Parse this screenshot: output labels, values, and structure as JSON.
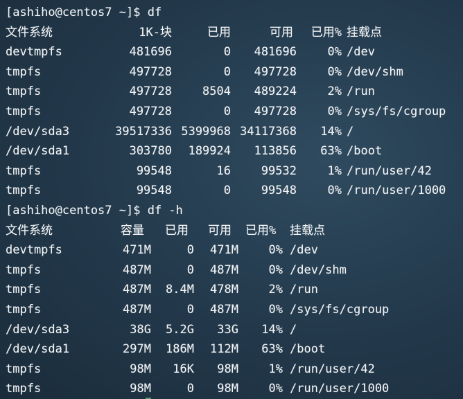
{
  "session1": {
    "prompt": "[ashiho@centos7 ~]$ ",
    "command": "df",
    "headers": [
      "文件系统",
      "1K-块",
      "已用",
      "可用",
      "已用%",
      "挂载点"
    ],
    "rows": [
      [
        "devtmpfs",
        "481696",
        "0",
        "481696",
        "0%",
        "/dev"
      ],
      [
        "tmpfs",
        "497728",
        "0",
        "497728",
        "0%",
        "/dev/shm"
      ],
      [
        "tmpfs",
        "497728",
        "8504",
        "489224",
        "2%",
        "/run"
      ],
      [
        "tmpfs",
        "497728",
        "0",
        "497728",
        "0%",
        "/sys/fs/cgroup"
      ],
      [
        "/dev/sda3",
        "39517336",
        "5399968",
        "34117368",
        "14%",
        "/"
      ],
      [
        "/dev/sda1",
        "303780",
        "189924",
        "113856",
        "63%",
        "/boot"
      ],
      [
        "tmpfs",
        "99548",
        "16",
        "99532",
        "1%",
        "/run/user/42"
      ],
      [
        "tmpfs",
        "99548",
        "0",
        "99548",
        "0%",
        "/run/user/1000"
      ]
    ]
  },
  "session2": {
    "prompt": "[ashiho@centos7 ~]$ ",
    "command": "df -h",
    "headers": [
      "文件系统",
      "容量",
      "已用",
      "可用",
      "已用%",
      "挂载点"
    ],
    "rows": [
      [
        "devtmpfs",
        "471M",
        "0",
        "471M",
        "0%",
        "/dev"
      ],
      [
        "tmpfs",
        "487M",
        "0",
        "487M",
        "0%",
        "/dev/shm"
      ],
      [
        "tmpfs",
        "487M",
        "8.4M",
        "478M",
        "2%",
        "/run"
      ],
      [
        "tmpfs",
        "487M",
        "0",
        "487M",
        "0%",
        "/sys/fs/cgroup"
      ],
      [
        "/dev/sda3",
        "38G",
        "5.2G",
        "33G",
        "14%",
        "/"
      ],
      [
        "/dev/sda1",
        "297M",
        "186M",
        "112M",
        "63%",
        "/boot"
      ],
      [
        "tmpfs",
        "98M",
        "16K",
        "98M",
        "1%",
        "/run/user/42"
      ],
      [
        "tmpfs",
        "98M",
        "0",
        "98M",
        "0%",
        "/run/user/1000"
      ]
    ]
  }
}
